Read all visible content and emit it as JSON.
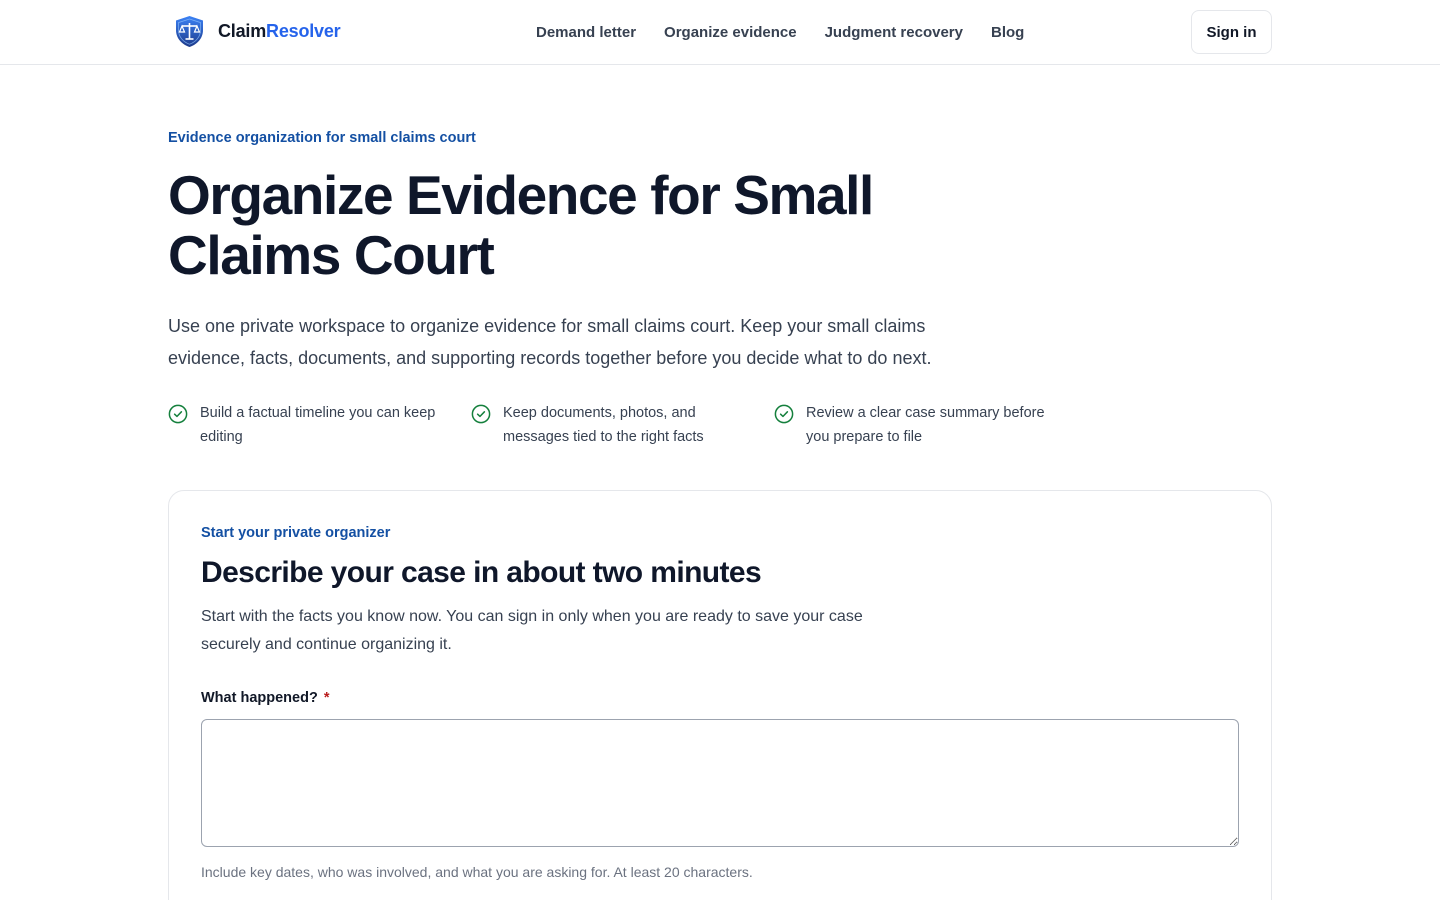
{
  "header": {
    "brand_part1": "Claim",
    "brand_part2": "Resolver",
    "nav": [
      {
        "label": "Demand letter"
      },
      {
        "label": "Organize evidence"
      },
      {
        "label": "Judgment recovery"
      },
      {
        "label": "Blog"
      }
    ],
    "signin_label": "Sign in"
  },
  "hero": {
    "eyebrow": "Evidence organization for small claims court",
    "title": "Organize Evidence for Small Claims Court",
    "subtitle": "Use one private workspace to organize evidence for small claims court. Keep your small claims evidence, facts, documents, and supporting records together before you decide what to do next.",
    "features": [
      {
        "icon": "check-circle-icon",
        "text": "Build a factual timeline you can keep editing"
      },
      {
        "icon": "check-circle-icon",
        "text": "Keep documents, photos, and messages tied to the right facts"
      },
      {
        "icon": "check-circle-icon",
        "text": "Review a clear case summary before you prepare to file"
      }
    ]
  },
  "card": {
    "eyebrow": "Start your private organizer",
    "title": "Describe your case in about two minutes",
    "subtitle": "Start with the facts you know now. You can sign in only when you are ready to save your case securely and continue organizing it.",
    "field_label": "What happened?",
    "required_mark": "*",
    "field_value": "",
    "hint": "Include key dates, who was involved, and what you are asking for. At least 20 characters."
  },
  "colors": {
    "accent": "#2563eb",
    "eyebrow": "#1450a3",
    "check": "#15803d",
    "required": "#b91c1c"
  }
}
